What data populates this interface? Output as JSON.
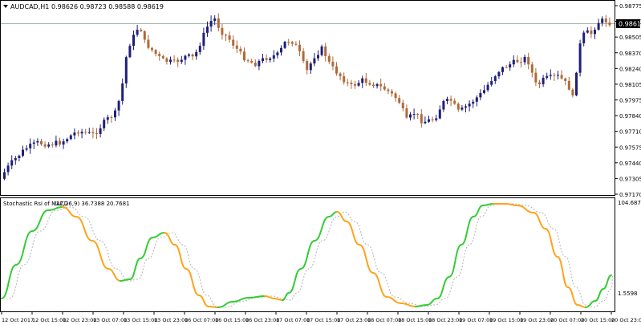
{
  "main": {
    "symbol": "AUDCAD,H1",
    "ohlc": "0.98626 0.98723 0.98588 0.98619",
    "title_icon": "triangle-down-icon",
    "current_price": "0.98619",
    "price_levels": [
      "0.98775",
      "0.98640",
      "0.98505",
      "0.98370",
      "0.98240",
      "0.98105",
      "0.97975",
      "0.97840",
      "0.97710",
      "0.97575",
      "0.97440",
      "0.97305",
      "0.97170"
    ],
    "bull_color": "#1f1f7a",
    "bear_color": "#b06a3a"
  },
  "indicator": {
    "name": "Stochastic Rsi of MACD",
    "params": "(12,26,9) 36.7388 20.7681",
    "top_value": "104.6877",
    "bottom_value": "1.5598",
    "up_color": "#33cc33",
    "down_color": "#ffa31a",
    "signal_color": "#b4b4b4"
  },
  "time_axis": {
    "labels": [
      "12 Oct 2017",
      "12 Oct 15:00",
      "12 Oct 23:00",
      "13 Oct 07:00",
      "13 Oct 15:00",
      "13 Oct 23:00",
      "16 Oct 07:00",
      "16 Oct 15:00",
      "16 Oct 23:00",
      "17 Oct 07:00",
      "17 Oct 15:00",
      "17 Oct 23:00",
      "18 Oct 07:00",
      "18 Oct 15:00",
      "18 Oct 23:00",
      "19 Oct 07:00",
      "19 Oct 15:00",
      "19 Oct 23:00",
      "20 Oct 07:00",
      "20 Oct 15:00",
      "20 Oct 23:00"
    ]
  }
}
